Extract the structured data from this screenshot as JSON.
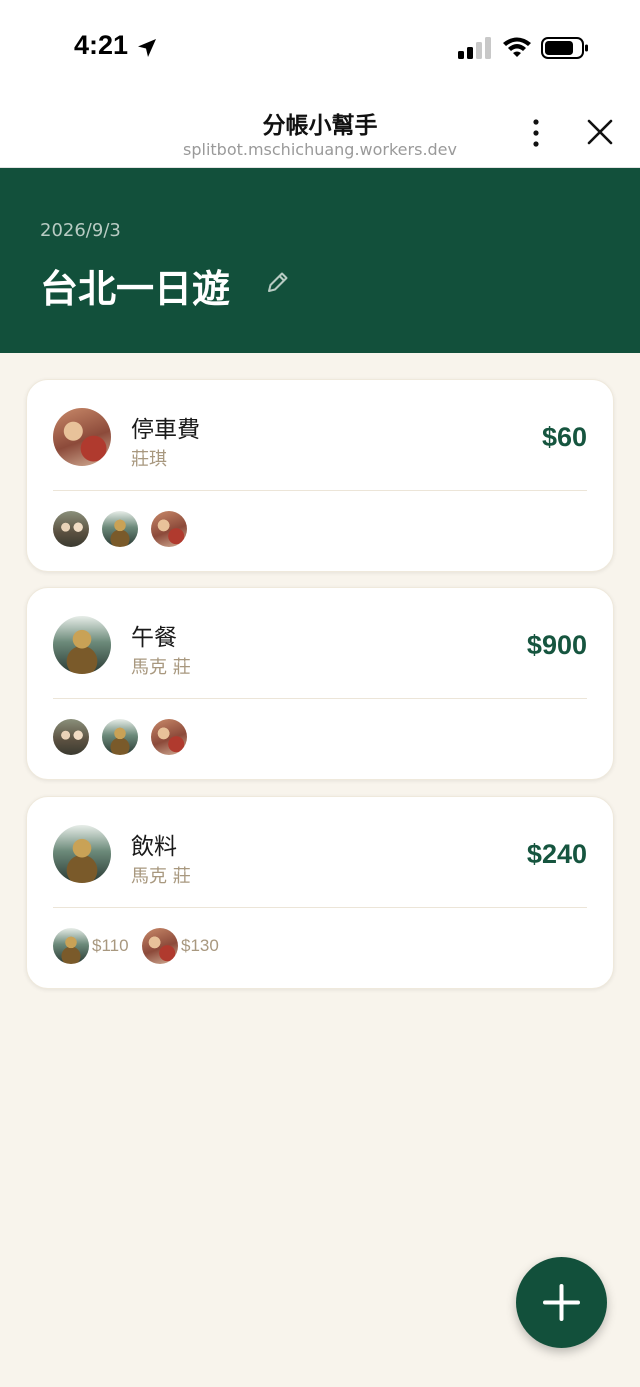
{
  "status_bar": {
    "time": "4:21"
  },
  "browser": {
    "title": "分帳小幫手",
    "url": "splitbot.mschichuang.workers.dev"
  },
  "trip": {
    "date": "2026/9/3",
    "title": "台北一日遊"
  },
  "expenses": [
    {
      "name": "停車費",
      "payer": "莊琪",
      "amount": "$60",
      "shares": []
    },
    {
      "name": "午餐",
      "payer": "馬克 莊",
      "amount": "$900",
      "shares": []
    },
    {
      "name": "飲料",
      "payer": "馬克 莊",
      "amount": "$240",
      "shares": [
        "$110",
        "$130"
      ]
    }
  ],
  "colors": {
    "primary": "#12503b",
    "background": "#f8f4ec",
    "muted_text": "#a8987f"
  },
  "icons": [
    "location-arrow-icon",
    "signal-icon",
    "wifi-icon",
    "battery-icon",
    "more-vertical-icon",
    "close-icon",
    "pencil-edit-icon",
    "plus-icon"
  ]
}
